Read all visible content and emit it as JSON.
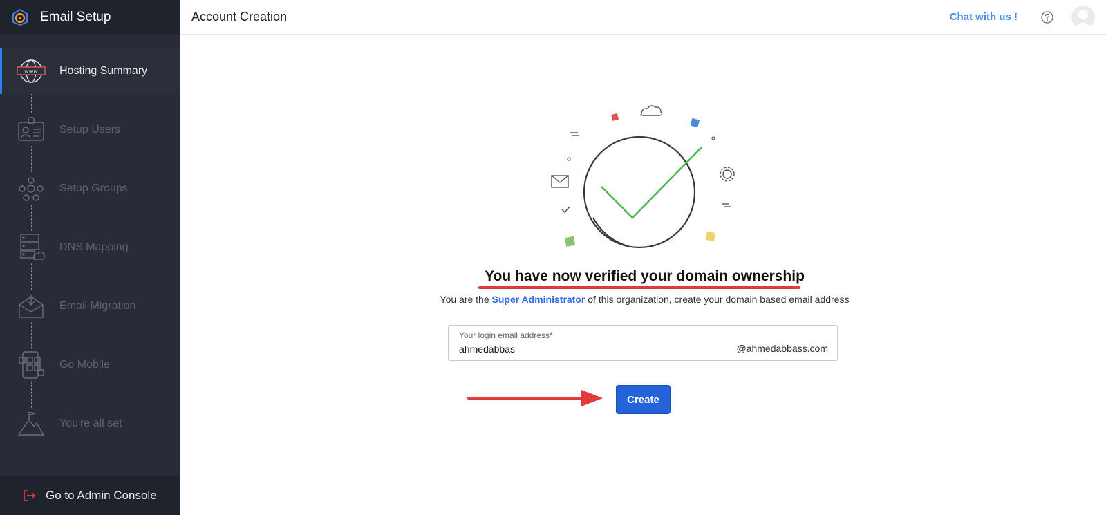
{
  "app": {
    "title": "Email Setup"
  },
  "header": {
    "page_title": "Account Creation",
    "chat_label": "Chat with us !"
  },
  "sidebar": {
    "steps": [
      {
        "label": "Hosting Summary",
        "icon": "globe-www-icon",
        "active": true
      },
      {
        "label": "Setup Users",
        "icon": "id-card-icon",
        "active": false
      },
      {
        "label": "Setup Groups",
        "icon": "group-network-icon",
        "active": false
      },
      {
        "label": "DNS Mapping",
        "icon": "server-cloud-icon",
        "active": false
      },
      {
        "label": "Email Migration",
        "icon": "envelope-download-icon",
        "active": false
      },
      {
        "label": "Go Mobile",
        "icon": "mobile-apps-icon",
        "active": false
      },
      {
        "label": "You're all set",
        "icon": "mountain-flag-icon",
        "active": false
      }
    ],
    "admin_link": "Go to Admin Console"
  },
  "main": {
    "headline": "You have now verified your domain ownership",
    "subline_prefix": "You are the",
    "subline_link": "Super Administrator",
    "subline_suffix": "of this organization, create your domain based email address",
    "email_field": {
      "label": "Your login email address",
      "required_mark": "*",
      "value": "ahmedabbas",
      "domain": "@ahmedabbass.com"
    },
    "create_label": "Create"
  },
  "colors": {
    "accent": "#2563d8",
    "link": "#4a8af4",
    "sidebar_bg": "#282c36",
    "check_green": "#4cb84c",
    "annotation_red": "#e03a3a"
  }
}
